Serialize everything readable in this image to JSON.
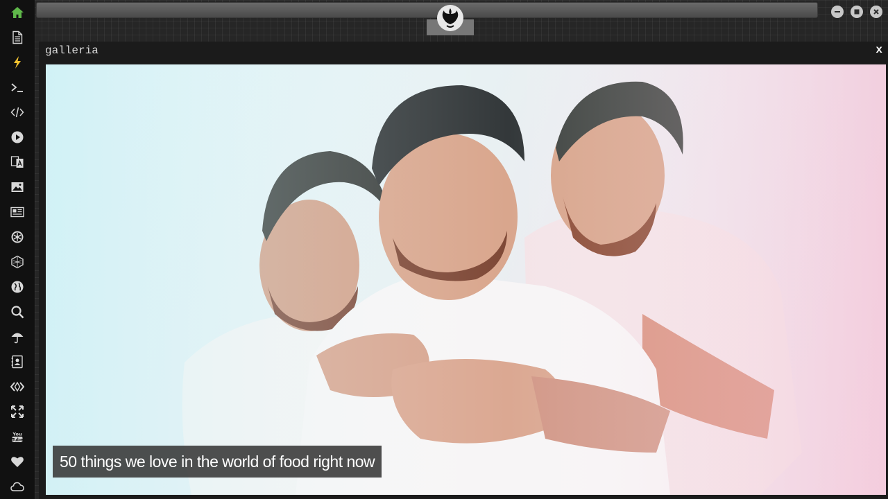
{
  "window": {
    "title": "galleria",
    "close_label": "x"
  },
  "gallery": {
    "caption": "50 things we love in the world of food right now"
  },
  "sidebar": {
    "items": [
      {
        "icon": "home-icon"
      },
      {
        "icon": "document-icon"
      },
      {
        "icon": "lightning-icon"
      },
      {
        "icon": "terminal-icon"
      },
      {
        "icon": "code-icon"
      },
      {
        "icon": "play-icon"
      },
      {
        "icon": "translate-icon"
      },
      {
        "icon": "image-icon"
      },
      {
        "icon": "news-icon"
      },
      {
        "icon": "settings-icon"
      },
      {
        "icon": "hexagon-icon"
      },
      {
        "icon": "globe-icon"
      },
      {
        "icon": "search-icon"
      },
      {
        "icon": "umbrella-icon"
      },
      {
        "icon": "contacts-icon"
      },
      {
        "icon": "embed-code-icon"
      },
      {
        "icon": "fullscreen-icon"
      },
      {
        "icon": "youtube-icon"
      },
      {
        "icon": "heart-icon"
      },
      {
        "icon": "cloud-icon"
      }
    ]
  },
  "colors": {
    "sidebar_bg": "#111111",
    "icon": "#d8d8d8",
    "home_icon": "#5fb84a",
    "lightning_icon": "#f2c230",
    "caption_bg": "#373737"
  }
}
